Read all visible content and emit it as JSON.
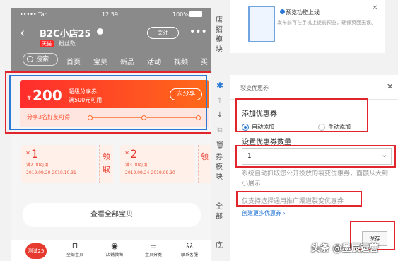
{
  "statusbar": {
    "carrier": "••••• Tao",
    "time": "12:59",
    "battery": "100%"
  },
  "store": {
    "back_icon": "back-chevron-icon",
    "name": "B2C小店25",
    "tag": "天猫",
    "subtitle": "粉丝数",
    "follow_label": "关注",
    "more_icon": "more-dots-icon"
  },
  "tabs": {
    "search_label": "搜索",
    "items": [
      "首页",
      "宝贝",
      "新品",
      "活动",
      "视频",
      "买"
    ]
  },
  "coupon_banner": {
    "currency": "¥",
    "amount": "200",
    "name": "超级分享券",
    "condition": "满500元可用",
    "share_label": "去分享",
    "share_hint": "分享3名好友可得"
  },
  "small_coupons": [
    {
      "currency": "¥",
      "amount": "1",
      "condition": "满2.00可用",
      "dates": "2019.09.20-2019.10.31",
      "claim_label": "领取"
    },
    {
      "currency": "¥",
      "amount": "2",
      "condition": "满3.00可用",
      "dates": "2019.09.24-2019.09.30",
      "claim_label": "领"
    }
  ],
  "all_items_label": "查看全部宝贝",
  "bottom_bar": {
    "badge": "测试25",
    "items": [
      {
        "label": "全部宝贝",
        "icon": "bag-icon"
      },
      {
        "label": "店铺微淘",
        "icon": "broadcast-icon"
      },
      {
        "label": "宝贝分类",
        "icon": "list-icon"
      },
      {
        "label": "联系客服",
        "icon": "headset-icon"
      }
    ]
  },
  "side_rail": {
    "top_text": [
      "店",
      "招",
      "模",
      "块"
    ],
    "coupon_module_text": [
      "券",
      "模",
      "块"
    ],
    "all_text": [
      "全",
      "部"
    ],
    "bottom_text": [
      "底",
      "\n"
    ]
  },
  "preview_card": {
    "title": "预览功能上线",
    "description": "发布前可在手机上提前预览，确保页面无误。",
    "close_icon": "close-icon"
  },
  "panel": {
    "title": "裂变优惠券",
    "add_coupon_label": "添加优惠券",
    "auto_add_label": "自动添加",
    "manual_add_label": "手动添加",
    "quantity_label": "设置优惠券数量",
    "quantity_value": "1",
    "description": "系统自动抓取您公开投放的裂变优惠券，面额从大到小展示",
    "only_support": "仅支持选择通用推广渠道裂变优惠券",
    "create_link": "创建更多优惠券 ›",
    "save_label": "保存"
  },
  "watermark": "头条 @墨辰运营",
  "colors": {
    "accent_blue": "#2b79d4",
    "annotation_red": "#e0262c",
    "coupon_red": "#ff2d2d"
  }
}
